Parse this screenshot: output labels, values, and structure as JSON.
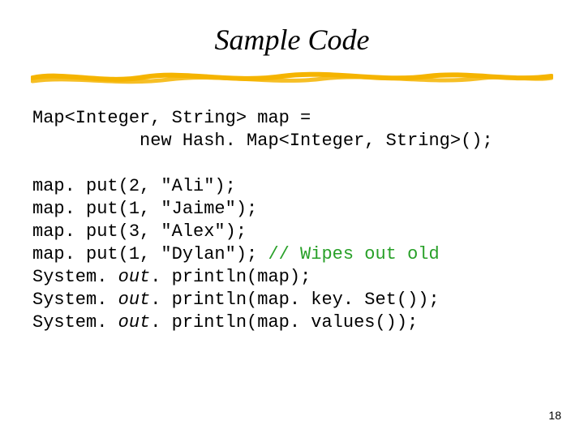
{
  "title": "Sample Code",
  "code": {
    "l1": "Map<Integer, String> map =",
    "l2": "          new Hash. Map<Integer, String>();",
    "l3": "",
    "l4": "map. put(2, \"Ali\");",
    "l5": "map. put(1, \"Jaime\");",
    "l6": "map. put(3, \"Alex\");",
    "l7a": "map. put(1, \"Dylan\"); ",
    "l7b": "// Wipes out old",
    "l8a": "System. ",
    "l8b": "out",
    "l8c": ". println(map);",
    "l9a": "System. ",
    "l9b": "out",
    "l9c": ". println(map. key. Set());",
    "l10a": "System. ",
    "l10b": "out",
    "l10c": ". println(map. values());"
  },
  "page_number": "18",
  "colors": {
    "underline": "#f5b400"
  }
}
